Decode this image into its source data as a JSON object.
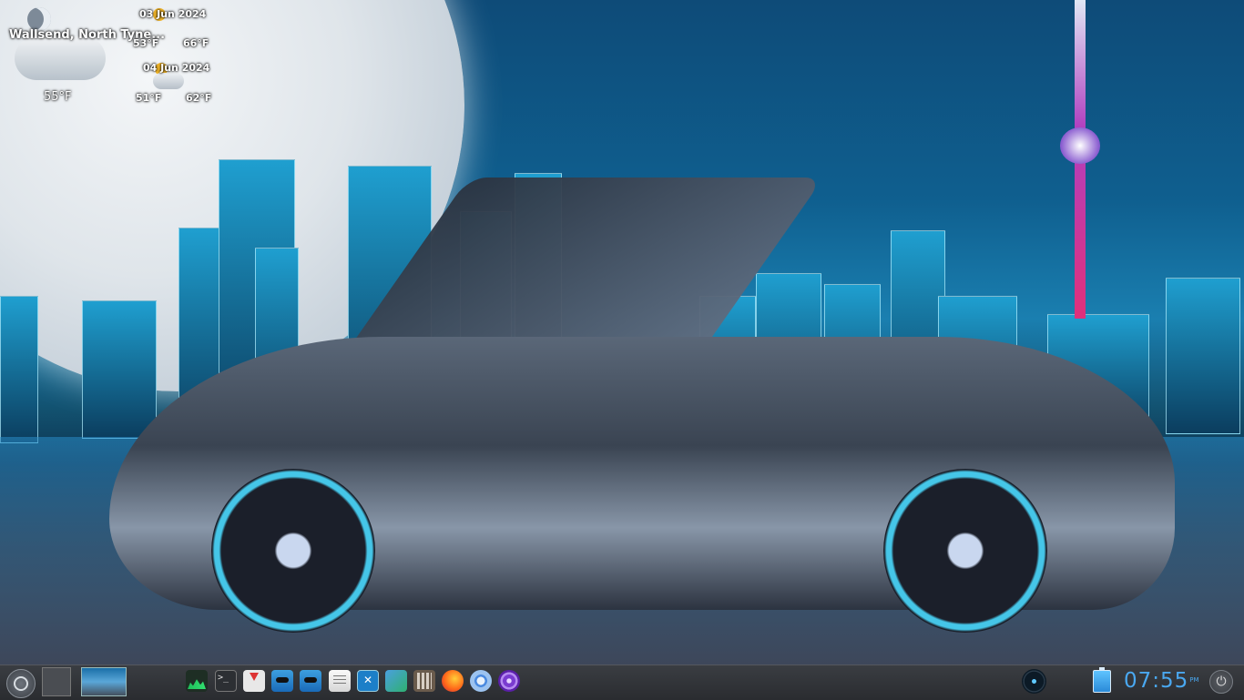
{
  "weather": {
    "location": "Wallsend, North Tyne...",
    "current_temp": "55°F",
    "forecast": [
      {
        "date": "03 Jun 2024",
        "low": "53°F",
        "high": "66°F"
      },
      {
        "date": "04 Jun 2024",
        "low": "51°F",
        "high": "62°F"
      }
    ],
    "icons": [
      "moon-icon",
      "cloud-icon",
      "sun-cloud-icon",
      "rain-icon"
    ]
  },
  "taskbar": {
    "apps": [
      "system-monitor-icon",
      "terminal-icon",
      "inbox-icon",
      "file-manager-icon",
      "file-manager-icon",
      "text-editor-icon",
      "screenshot-icon",
      "remote-desktop-icon",
      "calculator-icon",
      "firefox-icon",
      "chromium-icon",
      "tor-browser-icon"
    ],
    "terminal_glyph": ">_"
  },
  "clock": {
    "time": "07:55",
    "ampm": "PM"
  },
  "colors": {
    "clock": "#4aa8f0",
    "panel": "#2f3236",
    "accent": "#3da0e0"
  }
}
